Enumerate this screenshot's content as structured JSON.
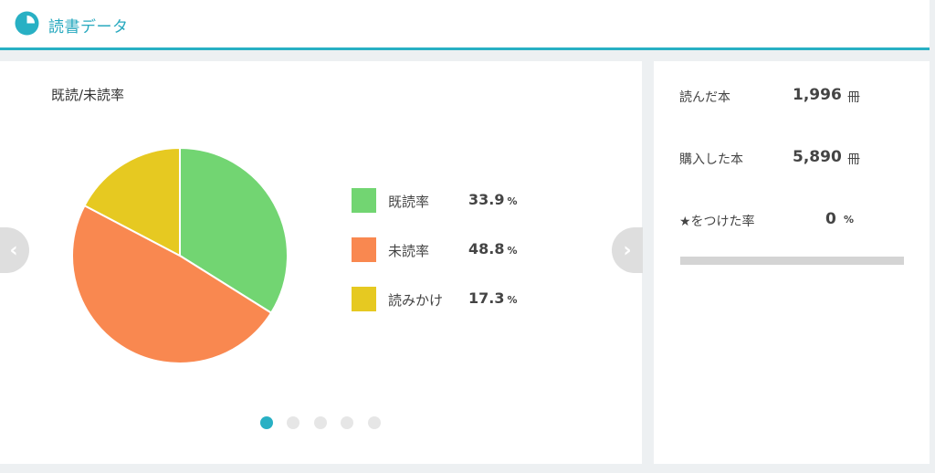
{
  "header": {
    "title": "読書データ",
    "icon": "pie-chart-icon",
    "accent_color": "#28b0c4"
  },
  "chart_data": {
    "type": "pie",
    "title": "既読/未読率",
    "categories": [
      "既読率",
      "未読率",
      "読みかけ"
    ],
    "values": [
      33.9,
      48.8,
      17.3
    ],
    "unit": "%",
    "colors": [
      "#72d572",
      "#f98850",
      "#e6c921"
    ],
    "legend": "right"
  },
  "legend": {
    "unit": "%",
    "items": [
      {
        "label": "既読率",
        "value": "33.9",
        "color": "#72d572"
      },
      {
        "label": "未読率",
        "value": "48.8",
        "color": "#f98850"
      },
      {
        "label": "読みかけ",
        "value": "17.3",
        "color": "#e6c921"
      }
    ]
  },
  "carousel": {
    "prev_icon": "chevron-left-icon",
    "next_icon": "chevron-right-icon",
    "page_count": 5,
    "active_page": 1
  },
  "stats": {
    "read": {
      "label": "読んだ本",
      "value": "1,996",
      "unit": "冊"
    },
    "purchased": {
      "label": "購入した本",
      "value": "5,890",
      "unit": "冊"
    },
    "starred": {
      "label": "★をつけた率",
      "value": "0",
      "unit": "%",
      "progress_percent": 0
    }
  }
}
